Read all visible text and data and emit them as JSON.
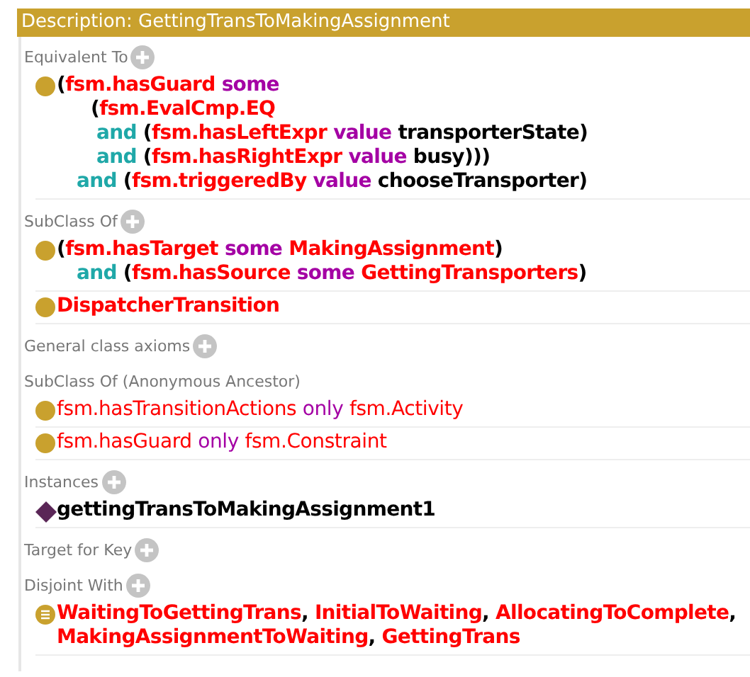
{
  "header": {
    "title": "Description: GettingTransToMakingAssignment"
  },
  "sections": [
    {
      "title": "Equivalent To",
      "add_button": true,
      "items": [
        {
          "kind": "class",
          "inferred": false,
          "lines": [
            {
              "kind": "first",
              "tokens": [
                {
                  "kind": "open",
                  "text": "("
                },
                {
                  "kind": "ent",
                  "text": "fsm.hasGuard"
                },
                {
                  "kind": "kw",
                  "text": "some"
                }
              ]
            },
            {
              "kind": "nested",
              "tokens": [
                {
                  "kind": "open",
                  "text": "("
                },
                {
                  "kind": "ent",
                  "text": "fsm.EvalCmp.EQ"
                }
              ]
            },
            {
              "kind": "nested-and",
              "tokens": [
                {
                  "kind": "and",
                  "text": "and"
                },
                {
                  "kind": "open",
                  "text": "("
                },
                {
                  "kind": "ent",
                  "text": "fsm.hasLeftExpr"
                },
                {
                  "kind": "kw",
                  "text": "value"
                },
                {
                  "kind": "ind",
                  "text": "transporterState"
                },
                {
                  "kind": "close",
                  "text": ")"
                }
              ]
            },
            {
              "kind": "nested-and",
              "tokens": [
                {
                  "kind": "and",
                  "text": "and"
                },
                {
                  "kind": "open",
                  "text": "("
                },
                {
                  "kind": "ent",
                  "text": "fsm.hasRightExpr"
                },
                {
                  "kind": "kw",
                  "text": "value"
                },
                {
                  "kind": "ind",
                  "text": "busy"
                },
                {
                  "kind": "close",
                  "text": ")))"
                }
              ]
            },
            {
              "kind": "and",
              "tokens": [
                {
                  "kind": "and",
                  "text": "and"
                },
                {
                  "kind": "open",
                  "text": "("
                },
                {
                  "kind": "ent",
                  "text": "fsm.triggeredBy"
                },
                {
                  "kind": "kw",
                  "text": "value"
                },
                {
                  "kind": "ind",
                  "text": "chooseTransporter"
                },
                {
                  "kind": "close",
                  "text": ")"
                }
              ]
            }
          ]
        }
      ]
    },
    {
      "title": "SubClass Of",
      "add_button": true,
      "items": [
        {
          "kind": "class",
          "inferred": false,
          "lines": [
            {
              "kind": "first",
              "tokens": [
                {
                  "kind": "open",
                  "text": "("
                },
                {
                  "kind": "ent",
                  "text": "fsm.hasTarget"
                },
                {
                  "kind": "kw",
                  "text": "some"
                },
                {
                  "kind": "ent",
                  "text": "MakingAssignment"
                },
                {
                  "kind": "close",
                  "text": ")"
                }
              ]
            },
            {
              "kind": "and",
              "tokens": [
                {
                  "kind": "and",
                  "text": "and"
                },
                {
                  "kind": "open",
                  "text": "("
                },
                {
                  "kind": "ent",
                  "text": "fsm.hasSource"
                },
                {
                  "kind": "kw",
                  "text": "some"
                },
                {
                  "kind": "ent",
                  "text": "GettingTransporters"
                },
                {
                  "kind": "close",
                  "text": ")"
                }
              ]
            }
          ]
        },
        {
          "kind": "class",
          "inferred": false,
          "lines": [
            {
              "kind": "first",
              "tokens": [
                {
                  "kind": "ent",
                  "text": "DispatcherTransition"
                }
              ]
            }
          ]
        }
      ]
    },
    {
      "title": "General class axioms",
      "add_button": true
    },
    {
      "title": "SubClass Of (Anonymous Ancestor)",
      "add_button": false,
      "items": [
        {
          "kind": "class",
          "inferred": true,
          "lines": [
            {
              "kind": "first",
              "tokens": [
                {
                  "kind": "ent",
                  "text": "fsm.hasTransitionActions"
                },
                {
                  "kind": "kw",
                  "text": "only"
                },
                {
                  "kind": "ent",
                  "text": "fsm.Activity"
                }
              ]
            }
          ]
        },
        {
          "kind": "class",
          "inferred": true,
          "lines": [
            {
              "kind": "first",
              "tokens": [
                {
                  "kind": "ent",
                  "text": "fsm.hasGuard"
                },
                {
                  "kind": "kw",
                  "text": "only"
                },
                {
                  "kind": "ent",
                  "text": "fsm.Constraint"
                }
              ]
            }
          ]
        }
      ]
    },
    {
      "title": "Instances",
      "add_button": true,
      "items": [
        {
          "kind": "individual",
          "inferred": false,
          "lines": [
            {
              "kind": "first",
              "tokens": [
                {
                  "kind": "ind",
                  "text": "gettingTransToMakingAssignment1"
                }
              ]
            }
          ]
        }
      ]
    },
    {
      "title": "Target for Key",
      "add_button": true
    },
    {
      "title": "Disjoint With",
      "add_button": true,
      "items": [
        {
          "kind": "disjoint",
          "inferred": false,
          "lines": [
            {
              "kind": "first",
              "tokens": [
                {
                  "kind": "ent",
                  "text": "WaitingToGettingTrans"
                },
                {
                  "kind": "comma",
                  "text": ","
                },
                {
                  "kind": "ent",
                  "text": "InitialToWaiting"
                },
                {
                  "kind": "comma",
                  "text": ","
                },
                {
                  "kind": "ent",
                  "text": "AllocatingToComplete"
                },
                {
                  "kind": "comma",
                  "text": ","
                }
              ]
            },
            {
              "kind": "first",
              "tokens": [
                {
                  "kind": "ent",
                  "text": "MakingAssignmentToWaiting"
                },
                {
                  "kind": "comma",
                  "text": ","
                },
                {
                  "kind": "ent",
                  "text": "GettingTrans"
                }
              ]
            }
          ]
        }
      ]
    }
  ]
}
